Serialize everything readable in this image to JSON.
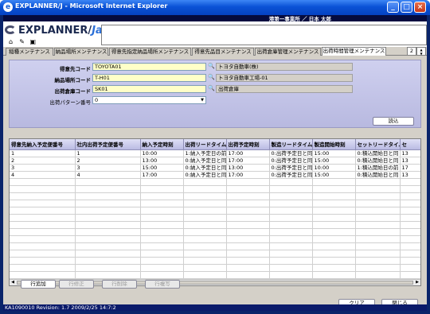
{
  "window": {
    "title": "EXPLANNER/J - Microsoft Internet Explorer",
    "minimize_glyph": "_",
    "maximize_glyph": "□",
    "close_glyph": "×"
  },
  "header": {
    "user": "港第一事業所 ／ 日本 太郎",
    "logo_main": "EXPLANNER/",
    "logo_ja": "Ja",
    "tool_icons": [
      "home-icon",
      "print-icon",
      "save-icon"
    ]
  },
  "tabs": {
    "items": [
      {
        "label": "稲種メンテナンス",
        "active": false
      },
      {
        "label": "納品場所メンテナンス",
        "active": false
      },
      {
        "label": "得意先指定納品場所メンテナンス",
        "active": false
      },
      {
        "label": "得意先品目メンテナンス",
        "active": false
      },
      {
        "label": "出荷倉庫管理メンテナンス",
        "active": false
      },
      {
        "label": "出荷時間管理メンテナンス",
        "active": true
      }
    ],
    "page_number": "2",
    "up_glyph": "▲",
    "down_glyph": "▼"
  },
  "form": {
    "customer_label": "得意先コード",
    "customer_code": "TOYOTA01",
    "customer_name": "トヨタ自動車(株)",
    "delivery_label": "納品場所コード",
    "delivery_code": "T-H01",
    "delivery_name": "トヨタ自動車工場-01",
    "warehouse_label": "出荷倉庫コード",
    "warehouse_code": "SK01",
    "warehouse_name": "出荷倉庫",
    "pattern_label": "出荷パターン番号",
    "pattern_value": "0",
    "dropdown_glyph": "▼",
    "search_glyph": "🔍",
    "read_button": "読込"
  },
  "grid": {
    "columns": [
      "得意先納入予定便番号",
      "社内出荷予定便番号",
      "納入予定時刻",
      "出荷リードタイム",
      "出荷予定時刻",
      "製造リードタイム",
      "製造開始時刻",
      "セットリードタイム",
      "セ"
    ],
    "rows": [
      [
        "1",
        "1",
        "10:00",
        "1:納入予定日の前",
        "17:00",
        "0:出荷予定日と同",
        "15:00",
        "0:積込開始日と同",
        "13"
      ],
      [
        "2",
        "2",
        "13:00",
        "0:納入予定日と同",
        "17:00",
        "0:出荷予定日と同",
        "15:00",
        "0:積込開始日と同",
        "13"
      ],
      [
        "3",
        "3",
        "15:00",
        "0:納入予定日と同",
        "13:00",
        "0:出荷予定日と同",
        "10:00",
        "1:積込開始日の前",
        "17"
      ],
      [
        "4",
        "4",
        "17:00",
        "0:納入予定日と同",
        "17:00",
        "0:出荷予定日と同",
        "15:00",
        "0:積込開始日と同",
        "13"
      ]
    ],
    "empty_rows": 17,
    "scroll_left_glyph": "◀",
    "scroll_right_glyph": "▶"
  },
  "actions": {
    "add": "行追加",
    "edit": "行修正",
    "delete": "行削除",
    "copy": "行複写",
    "clear": "クリア",
    "close": "閉じる"
  },
  "status": {
    "text": "KA1090010 Revision: 1.7 2009/2/25 14:7:2"
  }
}
